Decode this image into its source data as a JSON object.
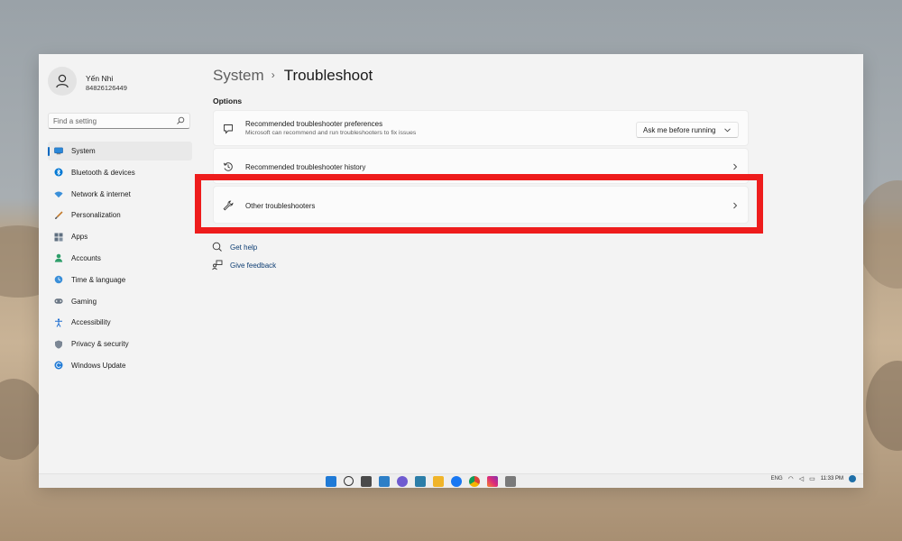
{
  "profile": {
    "name": "Yến Nhi",
    "id": "84826126449"
  },
  "search": {
    "placeholder": "Find a setting"
  },
  "nav": {
    "items": [
      {
        "label": "System",
        "icon": "monitor-icon",
        "active": true
      },
      {
        "label": "Bluetooth & devices",
        "icon": "bluetooth-icon"
      },
      {
        "label": "Network & internet",
        "icon": "wifi-icon"
      },
      {
        "label": "Personalization",
        "icon": "brush-icon"
      },
      {
        "label": "Apps",
        "icon": "apps-icon"
      },
      {
        "label": "Accounts",
        "icon": "person-icon"
      },
      {
        "label": "Time & language",
        "icon": "globe-clock-icon"
      },
      {
        "label": "Gaming",
        "icon": "gamepad-icon"
      },
      {
        "label": "Accessibility",
        "icon": "accessibility-icon"
      },
      {
        "label": "Privacy & security",
        "icon": "shield-icon"
      },
      {
        "label": "Windows Update",
        "icon": "refresh-icon"
      }
    ]
  },
  "header": {
    "crumb": "System",
    "separator": "›",
    "title": "Troubleshoot"
  },
  "options_label": "Options",
  "cards": {
    "preferences": {
      "title": "Recommended troubleshooter preferences",
      "subtitle": "Microsoft can recommend and run troubleshooters to fix issues",
      "dropdown_value": "Ask me before running"
    },
    "history": {
      "title": "Recommended troubleshooter history"
    },
    "other": {
      "title": "Other troubleshooters"
    }
  },
  "links": {
    "help": "Get help",
    "feedback": "Give feedback"
  },
  "taskbar": {
    "language": "ENG",
    "time": "11:33 PM"
  },
  "colors": {
    "accent": "#0067c0",
    "highlight": "#ee1c1c",
    "link": "#0e3e73"
  }
}
